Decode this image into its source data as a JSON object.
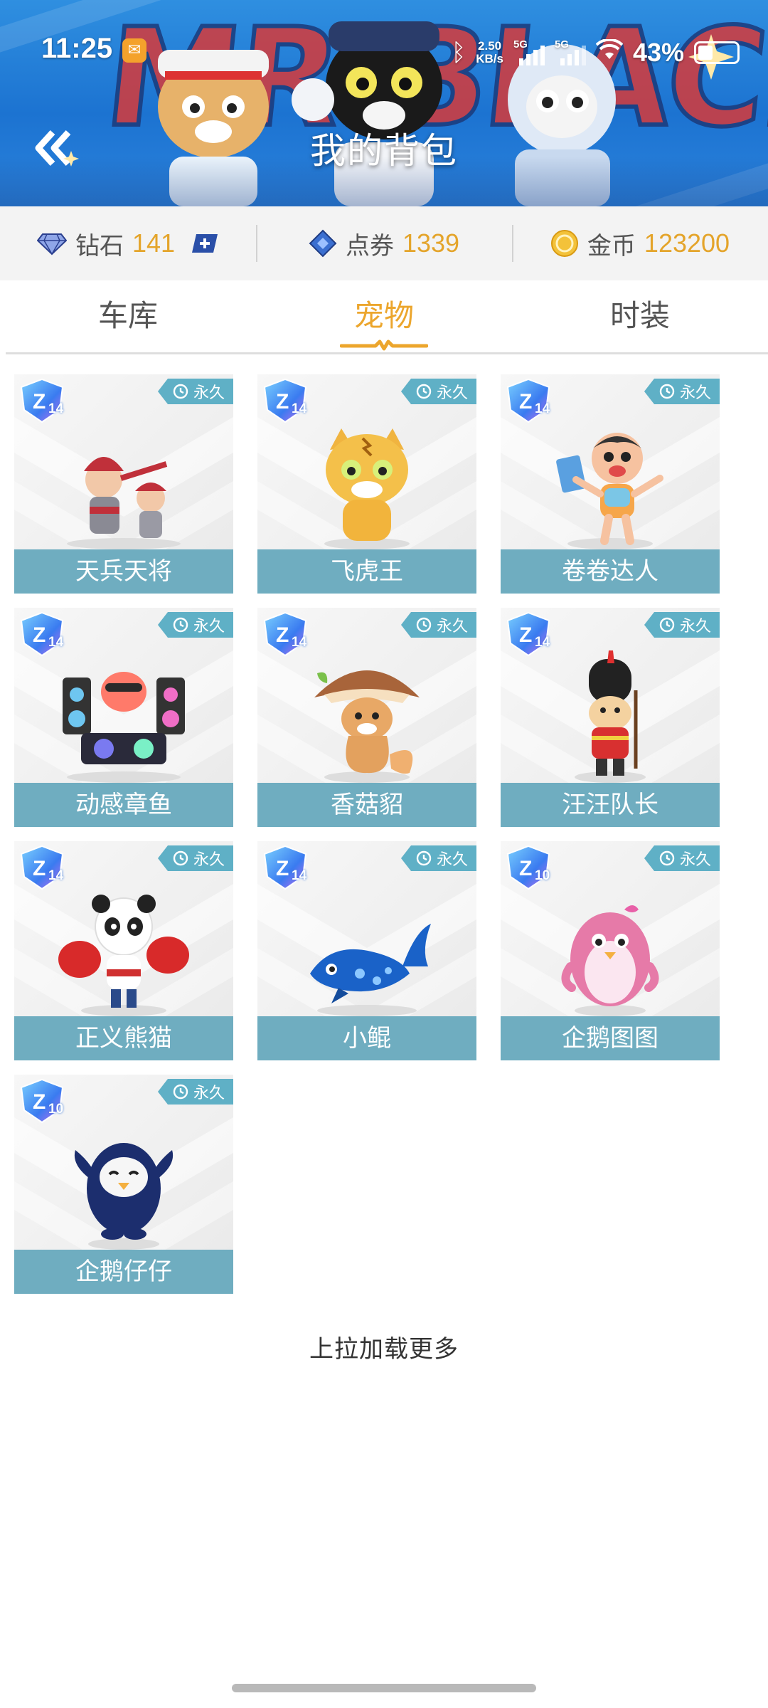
{
  "status_bar": {
    "time": "11:25",
    "network_speed_value": "2.50",
    "network_speed_unit": "KB/s",
    "signal_1_label": "5G",
    "signal_2_label": "5G",
    "battery_percent": "43%"
  },
  "header": {
    "title": "我的背包",
    "banner_text": "MR.BLACK"
  },
  "currency": [
    {
      "label": "钻石",
      "value": "141",
      "icon": "diamond-icon",
      "color": "#e4a42a"
    },
    {
      "label": "点券",
      "value": "1339",
      "icon": "coupon-icon",
      "color": "#e4a42a"
    },
    {
      "label": "金币",
      "value": "123200",
      "icon": "coin-icon",
      "color": "#e4a42a"
    }
  ],
  "tabs": [
    {
      "label": "车库",
      "active": false
    },
    {
      "label": "宠物",
      "active": true
    },
    {
      "label": "时装",
      "active": false
    }
  ],
  "pets": [
    {
      "name": "天兵天将",
      "level": "14",
      "duration": "永久",
      "art": "warrior-pair"
    },
    {
      "name": "飞虎王",
      "level": "14",
      "duration": "永久",
      "art": "tiger"
    },
    {
      "name": "卷卷达人",
      "level": "14",
      "duration": "永久",
      "art": "kid"
    },
    {
      "name": "动感章鱼",
      "level": "14",
      "duration": "永久",
      "art": "dj-octopus"
    },
    {
      "name": "香菇貂",
      "level": "14",
      "duration": "永久",
      "art": "mushroom-weasel"
    },
    {
      "name": "汪汪队长",
      "level": "14",
      "duration": "永久",
      "art": "guard-dog"
    },
    {
      "name": "正义熊猫",
      "level": "14",
      "duration": "永久",
      "art": "boxing-panda"
    },
    {
      "name": "小鲲",
      "level": "14",
      "duration": "永久",
      "art": "whale"
    },
    {
      "name": "企鹅图图",
      "level": "10",
      "duration": "永久",
      "art": "pink-penguin"
    },
    {
      "name": "企鹅仔仔",
      "level": "10",
      "duration": "永久",
      "art": "blue-penguin"
    }
  ],
  "footer": {
    "load_more": "上拉加载更多"
  },
  "colors": {
    "accent": "#eca62d",
    "card_label_bg": "#6fadc0",
    "header_blue": "#1c73d1"
  }
}
